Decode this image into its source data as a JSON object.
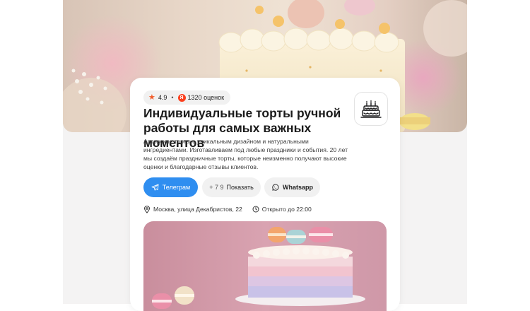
{
  "rating": {
    "score": "4.9",
    "separator": "•",
    "provider_letter": "Я",
    "reviews": "1320 оценок"
  },
  "title": "Индивидуальные торты ручной работы для самых важных моментов",
  "description": "Авторские торты с уникальным дизайном и натуральными ингредиентами. Изготавливаем под любые праздники и события. 20 лет мы создаём праздничные торты, которые неизменно получают высокие оценки и благодарные отзывы клиентов.",
  "buttons": {
    "telegram": "Телеграм",
    "phone_prefix": "+ 7 9",
    "phone_action": "Показать",
    "whatsapp": "Whatsapp"
  },
  "info": {
    "address": "Москва, улица Декабристов, 22",
    "hours": "Открыто до 22:00"
  },
  "icons": {
    "rating": "star-icon",
    "provider": "yandex-icon",
    "logo": "birthday-cake-icon",
    "telegram": "telegram-icon",
    "whatsapp": "whatsapp-icon",
    "location": "location-pin-icon",
    "clock": "clock-icon"
  },
  "colors": {
    "accent": "#2f8ef0",
    "star": "#f25c2a",
    "provider": "#fc3f1d"
  }
}
